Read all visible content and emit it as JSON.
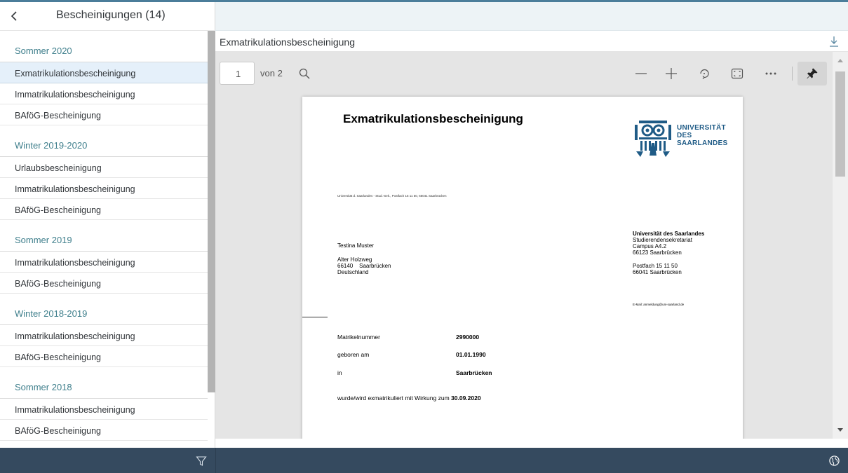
{
  "master": {
    "title": "Bescheinigungen (14)",
    "groups": [
      {
        "label": "Sommer 2020",
        "items": [
          "Exmatrikulationsbescheinigung",
          "Immatrikulationsbescheinigung",
          "BAföG-Bescheinigung"
        ]
      },
      {
        "label": "Winter 2019-2020",
        "items": [
          "Urlaubsbescheinigung",
          "Immatrikulationsbescheinigung",
          "BAföG-Bescheinigung"
        ]
      },
      {
        "label": "Sommer 2019",
        "items": [
          "Immatrikulationsbescheinigung",
          "BAföG-Bescheinigung"
        ]
      },
      {
        "label": "Winter 2018-2019",
        "items": [
          "Immatrikulationsbescheinigung",
          "BAföG-Bescheinigung"
        ]
      },
      {
        "label": "Sommer 2018",
        "items": [
          "Immatrikulationsbescheinigung",
          "BAföG-Bescheinigung"
        ]
      }
    ],
    "selected_item": "Exmatrikulationsbescheinigung"
  },
  "detail": {
    "title": "Exmatrikulationsbescheinigung"
  },
  "viewer": {
    "page_current": "1",
    "page_of": "von 2"
  },
  "pdf": {
    "heading": "Exmatrikulationsbescheinigung",
    "logo_text": [
      "UNIVERSITÄT",
      "DES",
      "SAARLANDES"
    ],
    "sender_line": "Universität d. Saarlandes - Stud.-Sek., Postfach 15 11 50, 66041 Saarbrücken",
    "recipient": {
      "name": "Testina Muster",
      "street": "Alter Holzweg",
      "city": "66140    Saarbrücken",
      "country": "Deutschland"
    },
    "university_address": {
      "name": "Universität des Saarlandes",
      "dept": "Studierendensekretariat",
      "campus": "Campus A4.2",
      "city": "66123 Saarbrücken",
      "postbox": "Postfach 15 11 50",
      "postbox_city": "66041 Saarbrücken",
      "email": "E-Mail: anmeldung@uni-saarland.de"
    },
    "rows": [
      {
        "label": "Matrikelnummer",
        "value": "2990000"
      },
      {
        "label": "geboren am",
        "value": "01.01.1990"
      },
      {
        "label": "in",
        "value": "Saarbrücken"
      }
    ],
    "exm_text": "wurde/wird exmatrikuliert mit Wirkung zum",
    "exm_date": "30.09.2020"
  },
  "colors": {
    "accent": "#3f7f8c",
    "footer": "#354a5f",
    "selected_bg": "#e5f0fa",
    "logo_blue": "#1f5b86"
  },
  "icons": [
    "back-icon",
    "filter-icon",
    "download-icon",
    "search-icon",
    "zoom-out-icon",
    "zoom-in-icon",
    "rotate-icon",
    "fit-page-icon",
    "more-icon",
    "pin-icon",
    "globe-icon"
  ]
}
